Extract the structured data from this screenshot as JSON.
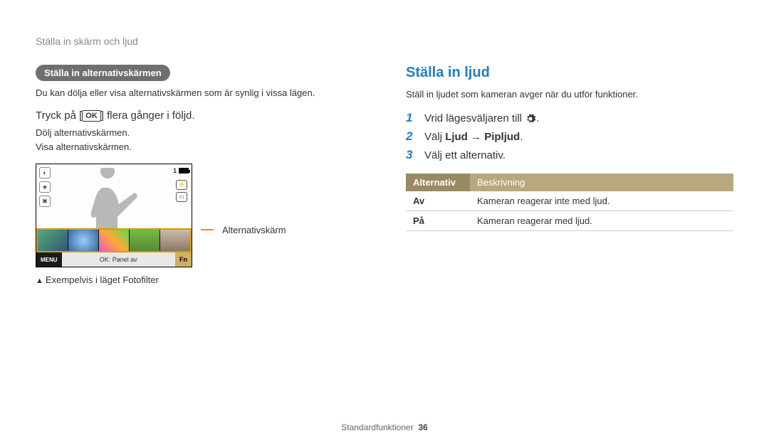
{
  "breadcrumb": "Ställa in skärm och ljud",
  "left": {
    "pill": "Ställa in alternativskärmen",
    "intro": "Du kan dölja eller visa alternativskärmen som är synlig i vissa lägen.",
    "instr_prefix": "Tryck på [",
    "instr_key": "OK",
    "instr_suffix": "] flera gånger i följd.",
    "sub1": "Dölj alternativskärmen.",
    "sub2": "Visa alternativskärmen.",
    "preview": {
      "topcount": "1",
      "menu": "MENU",
      "mid": "OK: Panel av",
      "fn": "Fn"
    },
    "callout": "Alternativskärm",
    "example": "Exempelvis i läget Fotofilter"
  },
  "right": {
    "heading": "Ställa in ljud",
    "intro": "Ställ in ljudet som kameran avger när du utför funktioner.",
    "steps": [
      {
        "num": "1",
        "text_pre": "Vrid lägesväljaren till ",
        "has_gear": true,
        "text_post": "."
      },
      {
        "num": "2",
        "text_pre": "Välj ",
        "bold1": "Ljud",
        "arrow": " → ",
        "bold2": "Pipljud",
        "text_post": "."
      },
      {
        "num": "3",
        "text_pre": "Välj ett alternativ.",
        "text_post": ""
      }
    ],
    "table": {
      "h1": "Alternativ",
      "h2": "Beskrivning",
      "rows": [
        {
          "opt": "Av",
          "desc": "Kameran reagerar inte med ljud."
        },
        {
          "opt": "På",
          "desc": "Kameran reagerar med ljud."
        }
      ]
    }
  },
  "footer": {
    "label": "Standardfunktioner",
    "page": "36"
  }
}
